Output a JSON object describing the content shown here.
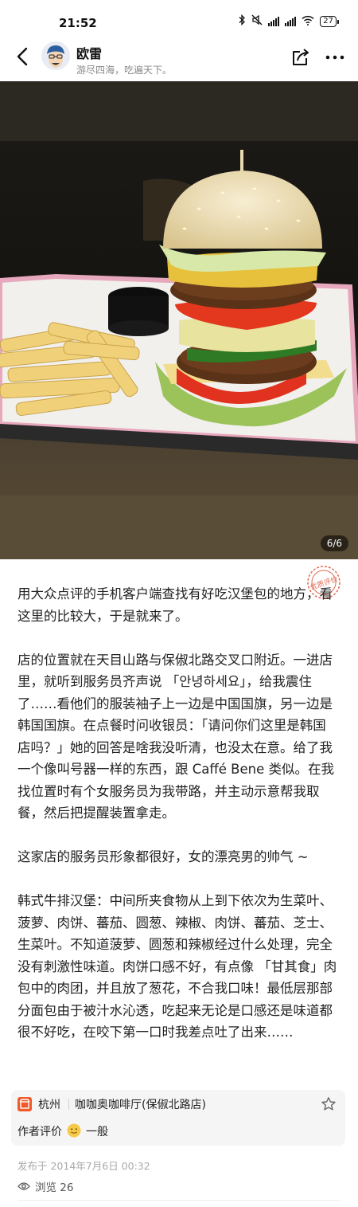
{
  "status_bar": {
    "time": "21:52",
    "battery": "27",
    "icons": [
      "bluetooth-icon",
      "mute-icon",
      "hd-signal-icon",
      "hd-signal-icon",
      "wifi-icon",
      "battery-icon"
    ]
  },
  "header": {
    "author_name": "欧雷",
    "author_bio": "游尽四海，吃遍天下。",
    "back_icon": "chevron-left-icon",
    "share_icon": "share-icon",
    "more_icon": "more-icon"
  },
  "photo": {
    "counter": "6/6"
  },
  "stamp": {
    "label": "优质评价",
    "color": "#e46b55"
  },
  "post": {
    "paragraphs": [
      "用大众点评的手机客户端查找有好吃汉堡包的地方，看这里的比较大，于是就来了。",
      "店的位置就在天目山路与保俶北路交叉口附近。一进店里，就听到服务员齐声说 「안녕하세요」，给我震住了……看他们的服装袖子上一边是中国国旗，另一边是韩国国旗。在点餐时问收银员：「请问你们这里是韩国店吗？」她的回答是啥我没听清，也没太在意。给了我一个像叫号器一样的东西，跟 Caffé Bene 类似。在我找位置时有个女服务员为我带路，并主动示意帮我取餐，然后把提醒装置拿走。",
      "这家店的服务员形象都很好，女的漂亮男的帅气 ~",
      "韩式牛排汉堡：中间所夹食物从上到下依次为生菜叶、菠萝、肉饼、蕃茄、圆葱、辣椒、肉饼、蕃茄、芝士、生菜叶。不知道菠萝、圆葱和辣椒经过什么处理，完全没有刺激性味道。肉饼口感不好，有点像 「甘其食」肉包中的肉团，并且放了葱花，不合我口味！最低层那部分面包由于被汁水沁透，吃起来无论是口感还是味道都很不好吃，在咬下第一口时我差点吐了出来……"
    ]
  },
  "place": {
    "city": "杭州",
    "name": "咖咖奥咖啡厅(保俶北路店)",
    "icon_color": "#f05a2a",
    "star_icon": "star-outline-icon",
    "rating_label": "作者评价",
    "rating_icon": "smile-face-icon",
    "rating_value": "一般"
  },
  "meta": {
    "publish_time": "发布于 2014年7月6日 00:32",
    "views_label": "浏览 26",
    "views_icon": "eye-icon"
  }
}
